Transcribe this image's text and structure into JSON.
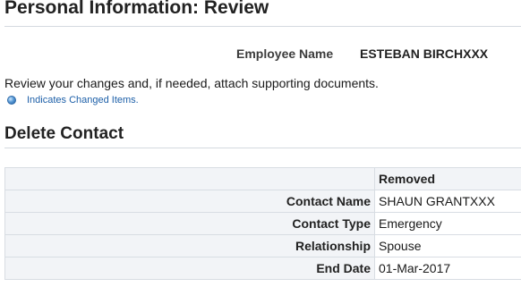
{
  "page": {
    "title": "Personal Information: Review"
  },
  "employee": {
    "label": "Employee Name",
    "value": "ESTEBAN BIRCHXXX"
  },
  "instructions": {
    "text": "Review your changes and, if needed, attach supporting documents.",
    "legend_text": "Indicates Changed Items.",
    "legend_icon": "changed-item-indicator",
    "legend_icon_color": "#2f6aa8"
  },
  "section": {
    "title": "Delete Contact",
    "column_header": "Removed",
    "rows": [
      {
        "label": "Contact Name",
        "value": "SHAUN GRANTXXX"
      },
      {
        "label": "Contact Type",
        "value": "Emergency"
      },
      {
        "label": "Relationship",
        "value": "Spouse"
      },
      {
        "label": "End Date",
        "value": "01-Mar-2017"
      }
    ]
  },
  "colors": {
    "label_background": "#f2f4f7",
    "border": "#d8dde3",
    "legend_link": "#1c5fa8"
  }
}
